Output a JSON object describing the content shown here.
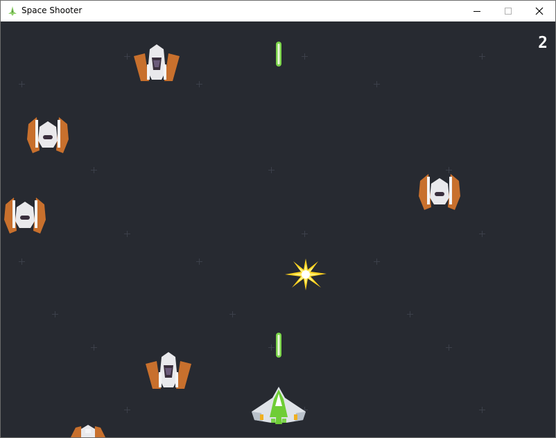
{
  "window": {
    "title": "Space Shooter",
    "controls": {
      "minimize": "minimize",
      "maximize": "maximize",
      "close": "close"
    }
  },
  "game": {
    "score": "2",
    "colors": {
      "background": "#272a31",
      "star": "#3c404a",
      "laser": "#7bd44a",
      "enemy_body": "#e9e9ec",
      "enemy_wing": "#c8702d",
      "player_accent": "#7ccf3d",
      "explosion": "#ffe23a"
    },
    "icons": [
      "app-ship-icon",
      "enemy-ship-sprite",
      "player-ship-sprite",
      "laser-bolt-sprite",
      "explosion-sprite"
    ]
  }
}
